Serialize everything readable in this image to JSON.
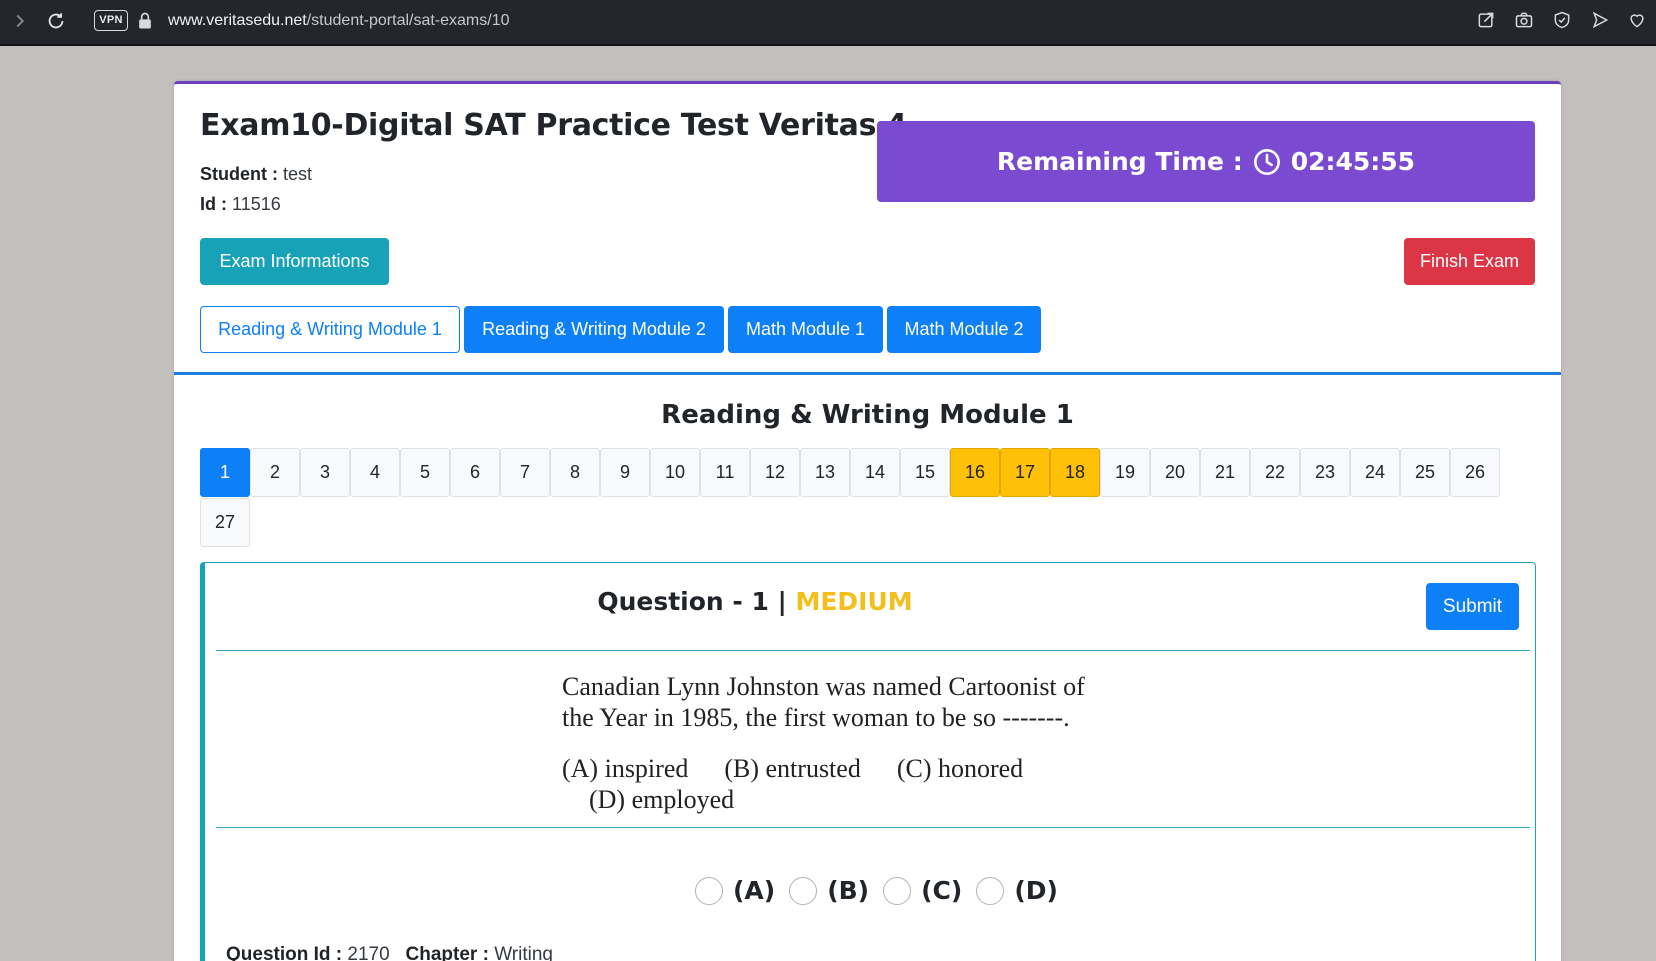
{
  "browser": {
    "vpn_label": "VPN",
    "url_domain": "www.veritasedu.net",
    "url_path": "/student-portal/sat-exams/10"
  },
  "exam": {
    "title": "Exam10-Digital SAT Practice Test Veritas 4",
    "student_label": "Student :",
    "student_value": "test",
    "id_label": "Id :",
    "id_value": "11516",
    "remaining_label": "Remaining Time :",
    "remaining_value": "02:45:55",
    "info_button": "Exam Informations",
    "finish_button": "Finish Exam"
  },
  "tabs": [
    {
      "label": "Reading & Writing Module 1",
      "active": true
    },
    {
      "label": "Reading & Writing Module 2",
      "active": false
    },
    {
      "label": "Math Module 1",
      "active": false
    },
    {
      "label": "Math Module 2",
      "active": false
    }
  ],
  "module": {
    "title": "Reading & Writing Module 1",
    "questions": [
      "1",
      "2",
      "3",
      "4",
      "5",
      "6",
      "7",
      "8",
      "9",
      "10",
      "11",
      "12",
      "13",
      "14",
      "15",
      "16",
      "17",
      "18",
      "19",
      "20",
      "21",
      "22",
      "23",
      "24",
      "25",
      "26",
      "27"
    ],
    "current": "1",
    "marked": [
      "16",
      "17",
      "18"
    ]
  },
  "question": {
    "heading": "Question - 1 |",
    "difficulty": "MEDIUM",
    "submit": "Submit",
    "text_line1": "Canadian Lynn Johnston was named Cartoonist of",
    "text_line2": "the Year in 1985, the first woman to be so -------.",
    "opt_a": "(A)  inspired",
    "opt_b": "(B)  entrusted",
    "opt_c": "(C)  honored",
    "opt_d": "(D)  employed",
    "answers": [
      "(A)",
      "(B)",
      "(C)",
      "(D)"
    ],
    "id_label": "Question Id :",
    "id_value": "2170",
    "chapter_label": "Chapter :",
    "chapter_value": "Writing"
  },
  "colors": {
    "accent_purple": "#7a4bd0",
    "primary_blue": "#0d7ff7",
    "info_teal": "#17a2b8",
    "danger_red": "#dc3545",
    "warning_yellow": "#ffc107",
    "difficulty_text": "#f4bf1d"
  }
}
